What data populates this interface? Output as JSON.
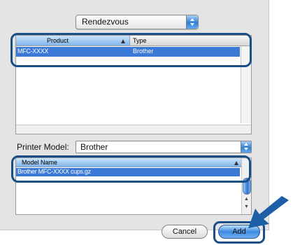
{
  "source_popup": {
    "value": "Rendezvous"
  },
  "printer_table": {
    "columns": [
      "Product",
      "Type"
    ],
    "rows": [
      {
        "product": "MFC-XXXX",
        "type": "Brother"
      }
    ]
  },
  "printer_model": {
    "label": "Printer Model:",
    "value": "Brother"
  },
  "model_list": {
    "column": "Model Name",
    "rows": [
      "Brother  MFC-XXXX cups.gz"
    ]
  },
  "buttons": {
    "cancel": "Cancel",
    "add": "Add"
  },
  "colors": {
    "selection": "#3b79d6",
    "callout": "#1a4f86",
    "accent": "#2f7fd9"
  }
}
